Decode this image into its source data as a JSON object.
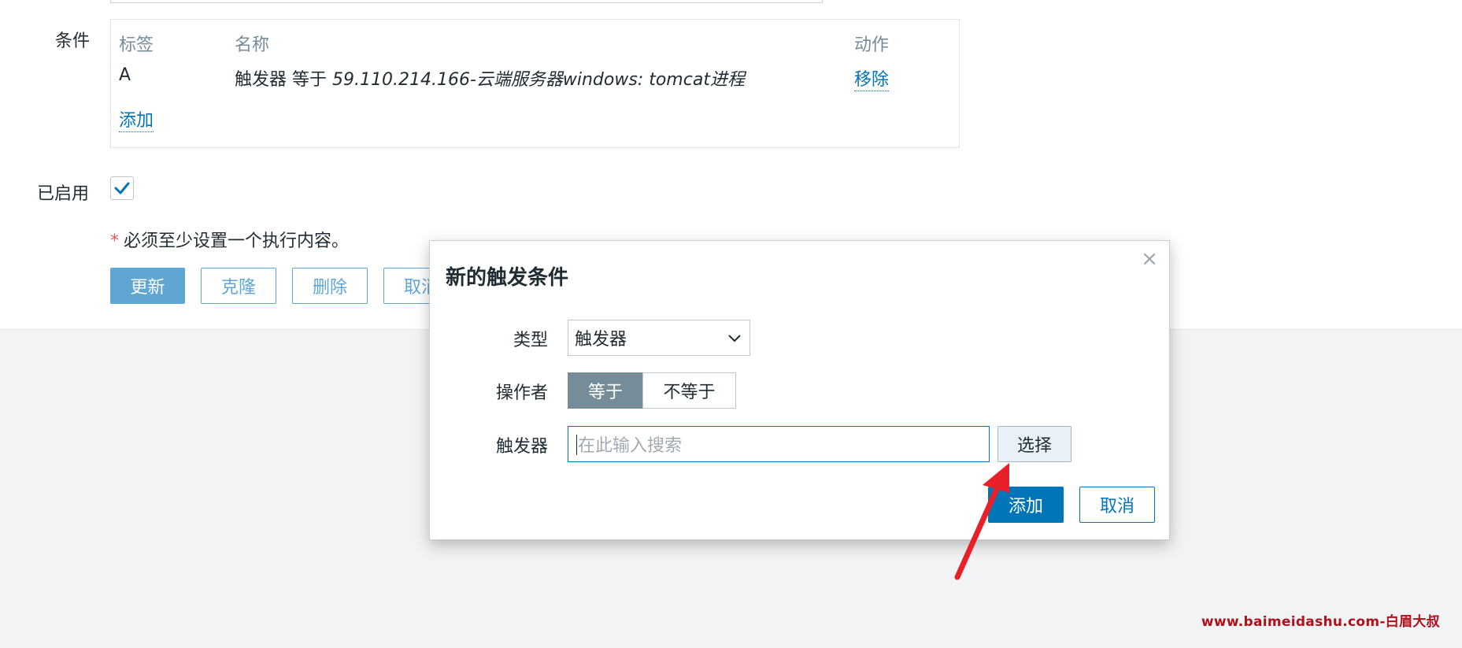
{
  "form": {
    "conditions_label": "条件",
    "conditions": {
      "headers": {
        "label": "标签",
        "name": "名称",
        "action": "动作"
      },
      "rows": [
        {
          "label": "A",
          "name_prefix": "触发器 等于 ",
          "name_value": "59.110.214.166-云端服务器windows: tomcat进程",
          "action": "移除"
        }
      ],
      "add_link": "添加"
    },
    "enabled_label": "已启用",
    "enabled": true,
    "required_note": "必须至少设置一个执行内容。",
    "required_star": "*",
    "buttons": {
      "update": "更新",
      "clone": "克隆",
      "delete": "删除",
      "cancel": "取消"
    }
  },
  "dialog": {
    "title": "新的触发条件",
    "close_icon": "×",
    "type_label": "类型",
    "type_value": "触发器",
    "operator_label": "操作者",
    "operator_options": [
      "等于",
      "不等于"
    ],
    "operator_selected": "等于",
    "trigger_label": "触发器",
    "trigger_placeholder": "在此输入搜索",
    "select_button": "选择",
    "add_button": "添加",
    "cancel_button": "取消"
  },
  "annotation": {
    "arrow_color": "#e8202a"
  },
  "watermark": "www.baimeidashu.com-白眉大叔",
  "colors": {
    "primary": "#0275b8",
    "segment_active": "#768d99",
    "muted_text": "#768d99"
  }
}
